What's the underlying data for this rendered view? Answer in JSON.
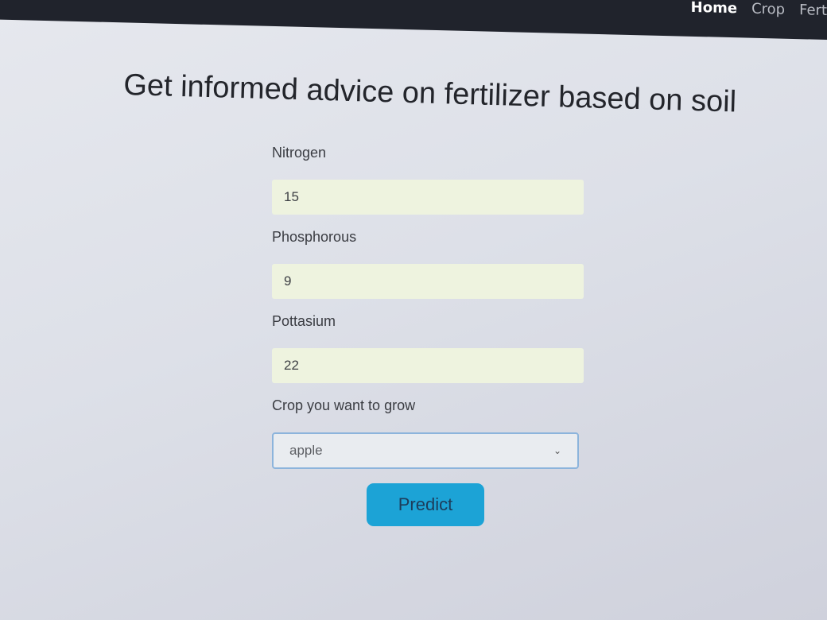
{
  "nav": {
    "items": [
      {
        "label": "Home",
        "active": true
      },
      {
        "label": "Crop",
        "active": false
      },
      {
        "label": "Fert",
        "active": false
      }
    ]
  },
  "page": {
    "title": "Get informed advice on fertilizer based on soil"
  },
  "form": {
    "nitrogen": {
      "label": "Nitrogen",
      "value": "15"
    },
    "phosphorous": {
      "label": "Phosphorous",
      "value": "9"
    },
    "potassium": {
      "label": "Pottasium",
      "value": "22"
    },
    "crop": {
      "label": "Crop you want to grow",
      "selected": "apple"
    },
    "submit_label": "Predict"
  },
  "colors": {
    "navbar": "#20232c",
    "button": "#1ca3d6",
    "input_bg": "#eef3df",
    "select_border": "#8cb4dc"
  },
  "icons": {
    "select_arrow": "chevron-down-icon"
  }
}
